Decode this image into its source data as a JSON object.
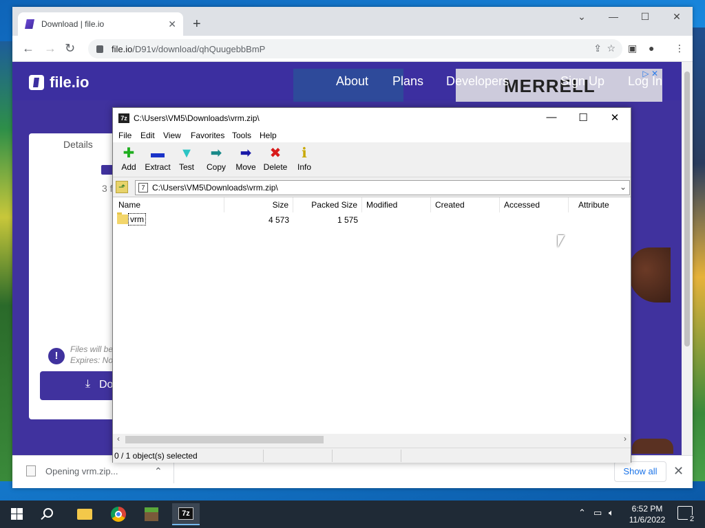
{
  "browser": {
    "tab_title": "Download | file.io",
    "url_host": "file.io",
    "url_path": "/D91v/download/qhQuugebbBmP"
  },
  "site": {
    "logo": "file.io",
    "nav": [
      "About",
      "Plans",
      "Developers",
      "Sign Up",
      "Log In"
    ],
    "ad_brand": "MERRELL",
    "card": {
      "tab": "Details",
      "count": "3 f",
      "note_line1": "Files will be",
      "note_line2": "Expires: No",
      "download_label": "Do"
    }
  },
  "download_bar": {
    "item": "Opening vrm.zip...",
    "show_all": "Show all"
  },
  "sevenzip": {
    "title": "C:\\Users\\VM5\\Downloads\\vrm.zip\\",
    "menu": [
      "File",
      "Edit",
      "View",
      "Favorites",
      "Tools",
      "Help"
    ],
    "tools": [
      {
        "label": "Add",
        "glyph": "✚",
        "color": "#1fae1f"
      },
      {
        "label": "Extract",
        "glyph": "▬",
        "color": "#1a33c8"
      },
      {
        "label": "Test",
        "glyph": "▼",
        "color": "#2cc4c4"
      },
      {
        "label": "Copy",
        "glyph": "➡",
        "color": "#1a8a8a"
      },
      {
        "label": "Move",
        "glyph": "➡",
        "color": "#1a1aa8"
      },
      {
        "label": "Delete",
        "glyph": "✖",
        "color": "#d81b1b"
      },
      {
        "label": "Info",
        "glyph": "ℹ",
        "color": "#c8a800"
      }
    ],
    "address": "C:\\Users\\VM5\\Downloads\\vrm.zip\\",
    "columns": [
      "Name",
      "Size",
      "Packed Size",
      "Modified",
      "Created",
      "Accessed",
      "Attribute"
    ],
    "rows": [
      {
        "name": "vrm",
        "size": "4 573",
        "packed": "1 575"
      }
    ],
    "status": "0 / 1 object(s) selected"
  },
  "taskbar": {
    "time": "6:52 PM",
    "date": "11/6/2022",
    "notifications": "2"
  }
}
